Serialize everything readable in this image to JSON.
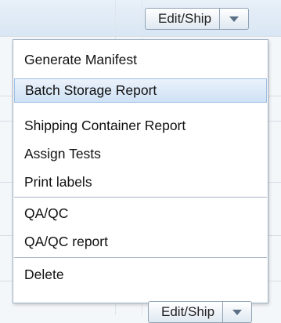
{
  "actions": {
    "button_label": "Edit/Ship",
    "menu": {
      "items": [
        {
          "label": "Generate Manifest"
        },
        {
          "label": "Batch Storage Report",
          "highlighted": true
        },
        {
          "label": "Shipping Container Report"
        },
        {
          "label": "Assign Tests"
        },
        {
          "label": "Print labels"
        },
        {
          "label": "QA/QC"
        },
        {
          "label": "QA/QC report"
        },
        {
          "label": "Delete"
        }
      ]
    }
  },
  "bottom_row": {
    "button_label": "Edit/Ship"
  },
  "colors": {
    "highlight": "#cfe1f4",
    "border": "#8fa2b6",
    "background": "#f4f7fa"
  }
}
